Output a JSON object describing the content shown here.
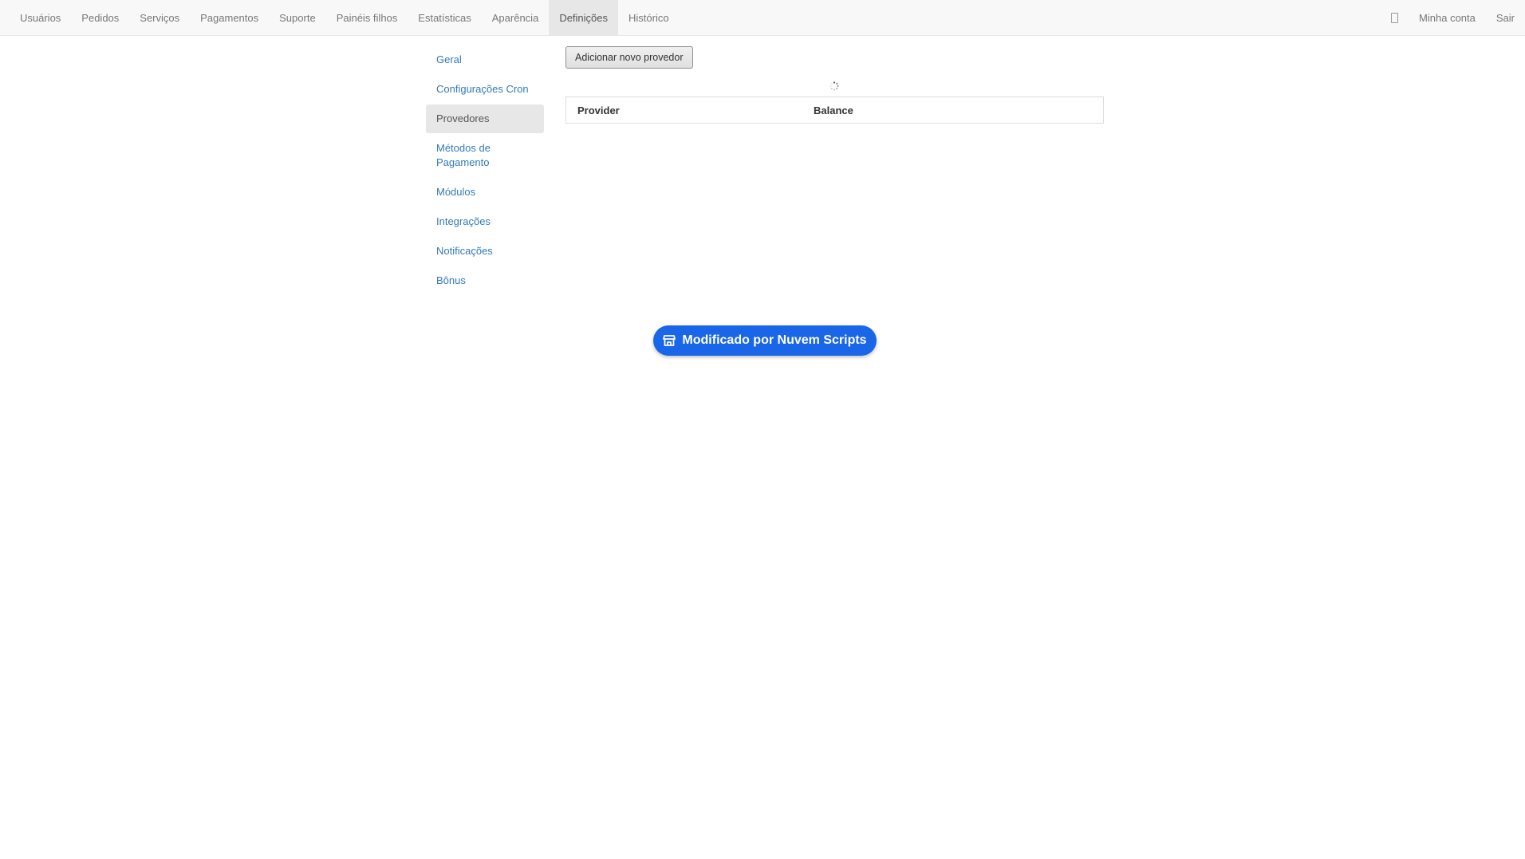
{
  "nav": {
    "left": [
      {
        "label": "Usuários",
        "active": false
      },
      {
        "label": "Pedidos",
        "active": false
      },
      {
        "label": "Serviços",
        "active": false
      },
      {
        "label": "Pagamentos",
        "active": false
      },
      {
        "label": "Suporte",
        "active": false
      },
      {
        "label": "Painéis filhos",
        "active": false
      },
      {
        "label": "Estatísticas",
        "active": false
      },
      {
        "label": "Aparência",
        "active": false
      },
      {
        "label": "Definições",
        "active": true
      },
      {
        "label": "Histórico",
        "active": false
      }
    ],
    "right": {
      "icon": "phone-icon",
      "account": "Minha conta",
      "logout": "Sair"
    }
  },
  "sidebar": {
    "items": [
      {
        "label": "Geral",
        "active": false
      },
      {
        "label": "Configurações Cron",
        "active": false
      },
      {
        "label": "Provedores",
        "active": true
      },
      {
        "label": "Métodos de Pagamento",
        "active": false
      },
      {
        "label": "Módulos",
        "active": false
      },
      {
        "label": "Integrações",
        "active": false
      },
      {
        "label": "Notificações",
        "active": false
      },
      {
        "label": "Bônus",
        "active": false
      }
    ]
  },
  "content": {
    "add_button": "Adicionar novo provedor",
    "table": {
      "columns": [
        "Provider",
        "Balance"
      ]
    }
  },
  "promo": {
    "label": "Modificado por Nuvem Scripts",
    "icon": "store-icon",
    "color": "#1a66e8"
  }
}
